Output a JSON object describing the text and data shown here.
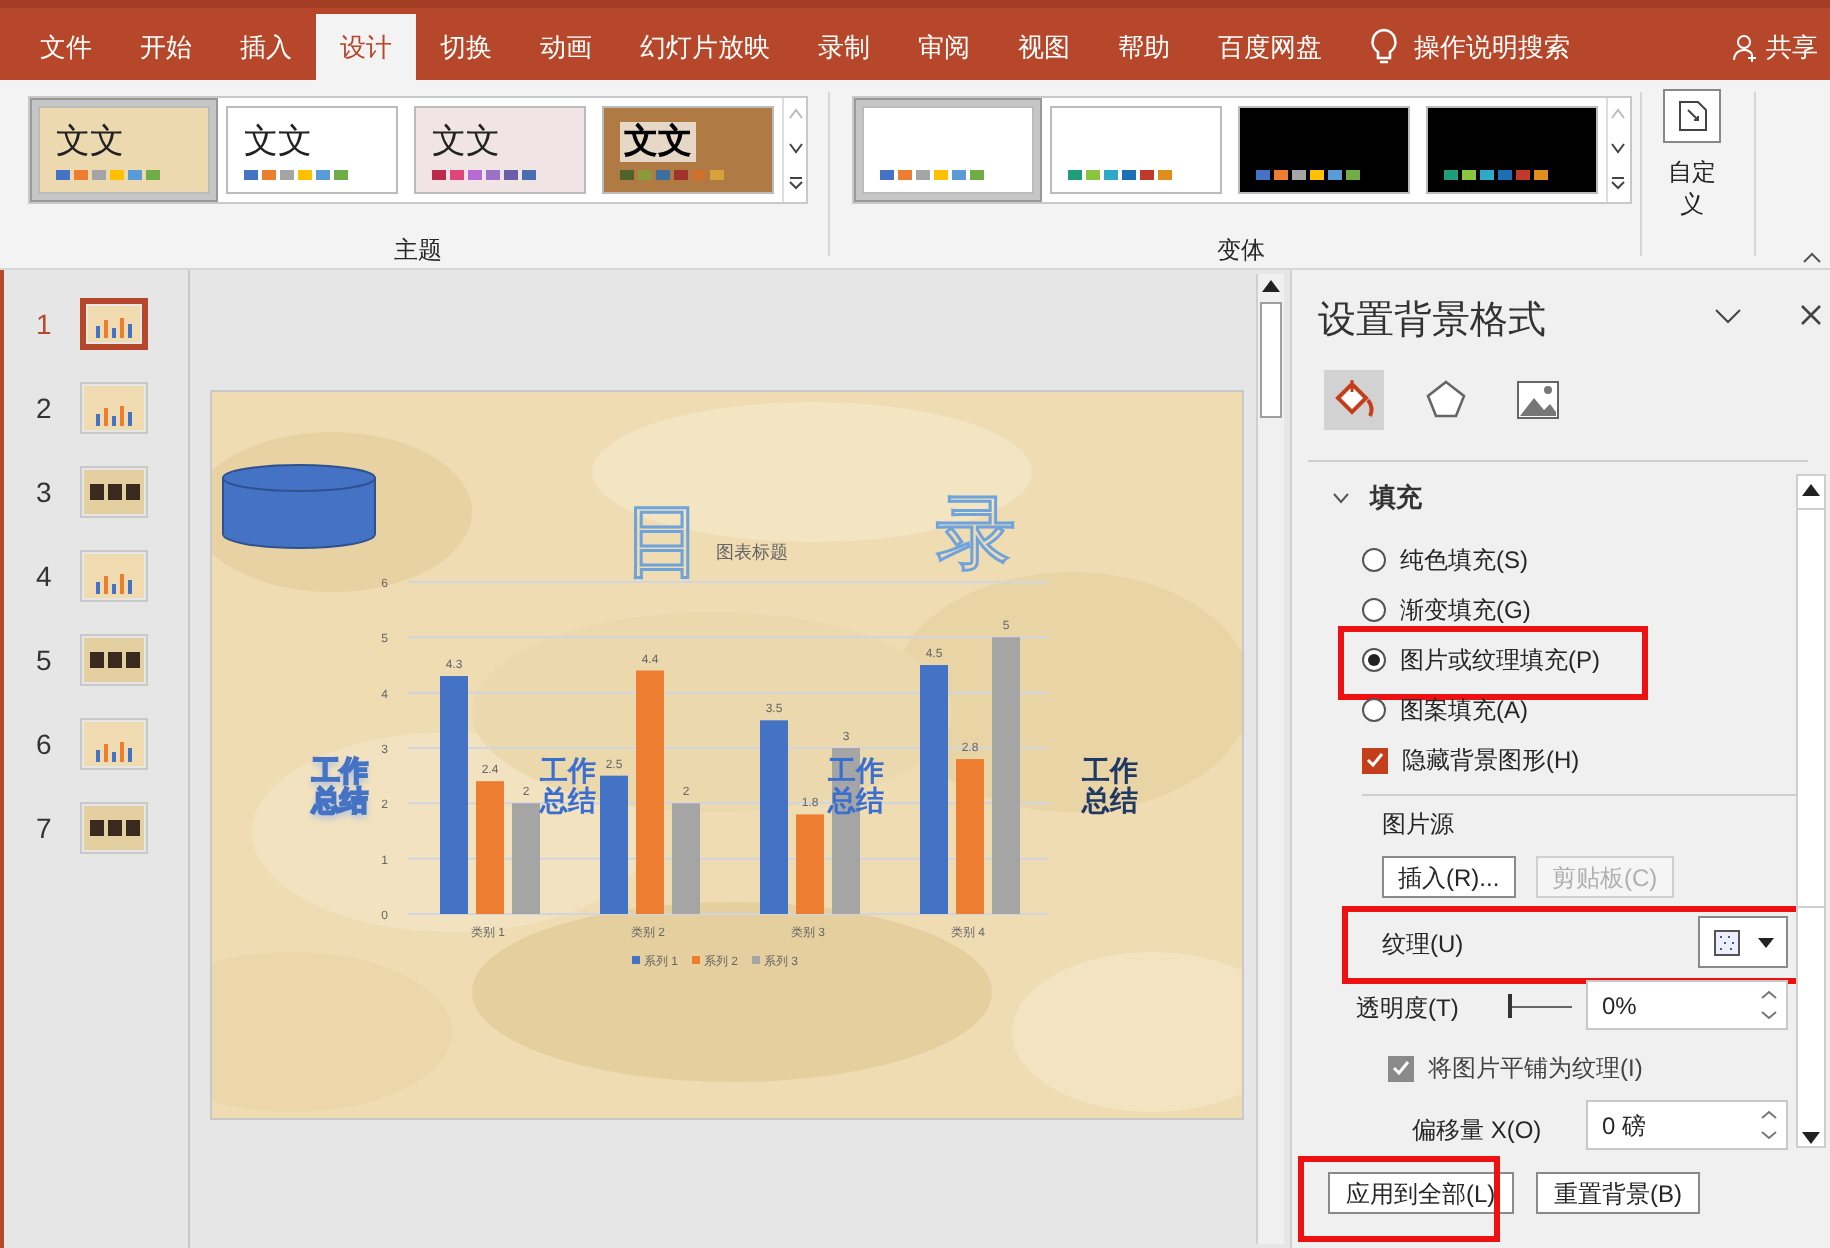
{
  "ribbon_tabs": [
    {
      "label": "文件",
      "selected": false
    },
    {
      "label": "开始",
      "selected": false
    },
    {
      "label": "插入",
      "selected": false
    },
    {
      "label": "设计",
      "selected": true
    },
    {
      "label": "切换",
      "selected": false
    },
    {
      "label": "动画",
      "selected": false
    },
    {
      "label": "幻灯片放映",
      "selected": false
    },
    {
      "label": "录制",
      "selected": false
    },
    {
      "label": "审阅",
      "selected": false
    },
    {
      "label": "视图",
      "selected": false
    },
    {
      "label": "帮助",
      "selected": false
    },
    {
      "label": "百度网盘",
      "selected": false
    }
  ],
  "tell_me": "操作说明搜索",
  "share": "共享",
  "themes": {
    "label": "主题",
    "items": [
      {
        "sample": "文文",
        "selected": true
      },
      {
        "sample": "文文",
        "selected": false
      },
      {
        "sample": "文文",
        "selected": false
      },
      {
        "sample": "文文",
        "selected": false
      }
    ]
  },
  "variants": {
    "label": "变体",
    "items": [
      {
        "selected": true
      },
      {
        "selected": false
      },
      {
        "selected": false
      },
      {
        "selected": false
      }
    ]
  },
  "customize": {
    "line_1": "自定",
    "line_2": "义"
  },
  "slides": [
    {
      "number": "1",
      "selected": true,
      "dark": false
    },
    {
      "number": "2",
      "selected": false,
      "dark": false
    },
    {
      "number": "3",
      "selected": false,
      "dark": true
    },
    {
      "number": "4",
      "selected": false,
      "dark": false
    },
    {
      "number": "5",
      "selected": false,
      "dark": true
    },
    {
      "number": "6",
      "selected": false,
      "dark": false
    },
    {
      "number": "7",
      "selected": false,
      "dark": true
    }
  ],
  "slide": {
    "shapes": [
      {
        "kind": "cylinder"
      },
      {
        "kind": "outline",
        "text": "目"
      },
      {
        "kind": "outline",
        "text": "录"
      },
      {
        "kind": "wordart",
        "text": "工作总结"
      },
      {
        "kind": "wordart",
        "text": "工作总结"
      },
      {
        "kind": "wordart",
        "text": "工作总结"
      },
      {
        "kind": "wordart",
        "text": "工作总结"
      }
    ],
    "chart_data": {
      "type": "bar",
      "title": "图表标题",
      "categories": [
        "类别 1",
        "类别 2",
        "类别 3",
        "类别 4"
      ],
      "series": [
        {
          "name": "系列 1",
          "color": "#4472c4",
          "values": [
            4.3,
            2.5,
            3.5,
            4.5
          ]
        },
        {
          "name": "系列 2",
          "color": "#ed7d31",
          "values": [
            2.4,
            4.4,
            1.8,
            2.8
          ]
        },
        {
          "name": "系列 3",
          "color": "#a5a5a5",
          "values": [
            2,
            2,
            3,
            5
          ]
        }
      ],
      "ylim": [
        0,
        6
      ],
      "yticks": [
        {
          "value": 0,
          "label": "0"
        },
        {
          "value": 1,
          "label": "1"
        },
        {
          "value": 2,
          "label": "2"
        },
        {
          "value": 3,
          "label": "3"
        },
        {
          "value": 4,
          "label": "4"
        },
        {
          "value": 5,
          "label": "5"
        },
        {
          "value": 6,
          "label": "6"
        }
      ],
      "data_labels": true,
      "grid": true,
      "legend": true
    }
  },
  "format_pane": {
    "title": "设置背景格式",
    "tabs": [
      {
        "kind": "fill",
        "selected": true
      },
      {
        "kind": "effects",
        "selected": false
      },
      {
        "kind": "picture",
        "selected": false
      }
    ],
    "section": {
      "label": "填充",
      "expanded": true
    },
    "fill_options": [
      {
        "label": "纯色填充(S)",
        "selected": false,
        "highlighted": false
      },
      {
        "label": "渐变填充(G)",
        "selected": false,
        "highlighted": false
      },
      {
        "label": "图片或纹理填充(P)",
        "selected": true,
        "highlighted": true
      },
      {
        "label": "图案填充(A)",
        "selected": false,
        "highlighted": false
      }
    ],
    "hide_background_graphics": {
      "label": "隐藏背景图形(H)",
      "checked": true
    },
    "picture_source": {
      "label": "图片源",
      "buttons": [
        {
          "label": "插入(R)...",
          "disabled": false
        },
        {
          "label": "剪贴板(C)",
          "disabled": true
        }
      ]
    },
    "texture": {
      "label": "纹理(U)",
      "highlighted": true
    },
    "transparency": {
      "label": "透明度(T)",
      "level": 0,
      "value": "0%"
    },
    "tile_as_texture": {
      "label": "将图片平铺为纹理(I)",
      "checked": true
    },
    "offset_x": {
      "label": "偏移量 X(O)",
      "value": "0 磅"
    },
    "buttons": [
      {
        "label": "应用到全部(L)",
        "highlighted": true
      },
      {
        "label": "重置背景(B)",
        "highlighted": false
      }
    ]
  }
}
